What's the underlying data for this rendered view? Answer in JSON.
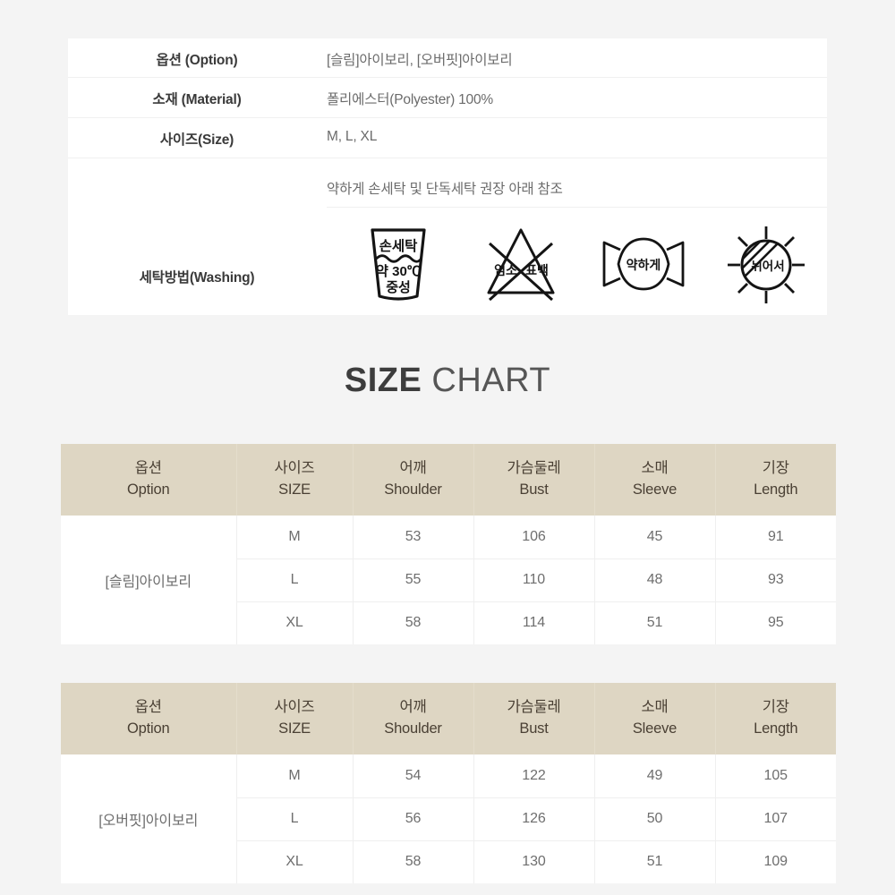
{
  "info_table": {
    "rows": [
      {
        "label": "옵션 (Option)",
        "value": "[슬림]아이보리, [오버핏]아이보리"
      },
      {
        "label": "소재 (Material)",
        "value": "폴리에스터(Polyester) 100%"
      },
      {
        "label": "사이즈(Size)",
        "value": "M, L, XL"
      }
    ],
    "washing": {
      "label": "세탁방법(Washing)",
      "note": "약하게 손세탁 및 단독세탁 권장 아래 참조",
      "symbols": [
        {
          "name": "hand-wash-basin-icon",
          "top_text": "손세탁",
          "line1": "약 30℃",
          "line2": "중성"
        },
        {
          "name": "no-chlorine-bleach-icon",
          "left_text": "염소",
          "right_text": "표백"
        },
        {
          "name": "gentle-wring-icon",
          "center_text": "약하게"
        },
        {
          "name": "dry-flat-shade-icon",
          "center_text": "뉘어서"
        }
      ]
    }
  },
  "chart_title": {
    "bold": "SIZE",
    "light": "CHART"
  },
  "size_tables": [
    {
      "id": "slim-size-table",
      "headers": [
        {
          "kr": "옵션",
          "en": "Option"
        },
        {
          "kr": "사이즈",
          "en": "SIZE"
        },
        {
          "kr": "어깨",
          "en": "Shoulder"
        },
        {
          "kr": "가슴둘레",
          "en": "Bust"
        },
        {
          "kr": "소매",
          "en": "Sleeve"
        },
        {
          "kr": "기장",
          "en": "Length"
        }
      ],
      "option": "[슬림]아이보리",
      "rows": [
        {
          "size": "M",
          "shoulder": "53",
          "bust": "106",
          "sleeve": "45",
          "length": "91"
        },
        {
          "size": "L",
          "shoulder": "55",
          "bust": "110",
          "sleeve": "48",
          "length": "93"
        },
        {
          "size": "XL",
          "shoulder": "58",
          "bust": "114",
          "sleeve": "51",
          "length": "95"
        }
      ]
    },
    {
      "id": "overfit-size-table",
      "headers": [
        {
          "kr": "옵션",
          "en": "Option"
        },
        {
          "kr": "사이즈",
          "en": "SIZE"
        },
        {
          "kr": "어깨",
          "en": "Shoulder"
        },
        {
          "kr": "가슴둘레",
          "en": "Bust"
        },
        {
          "kr": "소매",
          "en": "Sleeve"
        },
        {
          "kr": "기장",
          "en": "Length"
        }
      ],
      "option": "[오버핏]아이보리",
      "rows": [
        {
          "size": "M",
          "shoulder": "54",
          "bust": "122",
          "sleeve": "49",
          "length": "105"
        },
        {
          "size": "L",
          "shoulder": "56",
          "bust": "126",
          "sleeve": "50",
          "length": "107"
        },
        {
          "size": "XL",
          "shoulder": "58",
          "bust": "130",
          "sleeve": "51",
          "length": "109"
        }
      ]
    }
  ],
  "colors": {
    "page_background": "#f4f4f4",
    "card_background": "#ffffff",
    "table_header": "#ded6c3",
    "header_text": "#4a4034",
    "body_text": "#6e6e6e",
    "label_text": "#3a3a3a"
  }
}
